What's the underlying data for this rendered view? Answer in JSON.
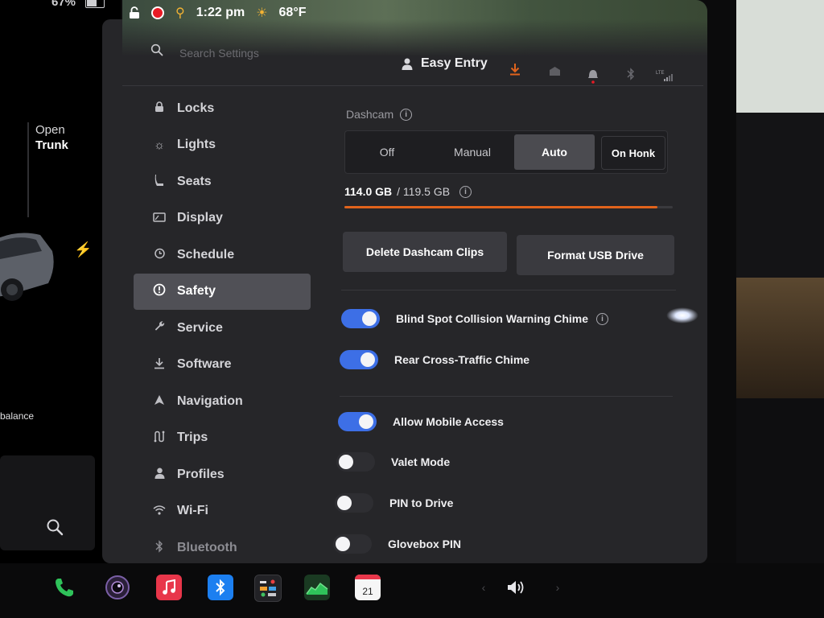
{
  "left_panel": {
    "battery": "67%",
    "trunk_line1": "Open",
    "trunk_line2": "Trunk",
    "balance_text": "balance"
  },
  "status": {
    "time": "1:22 pm",
    "temperature": "68°F"
  },
  "header": {
    "search_placeholder": "Search Settings",
    "profile_name": "Easy Entry",
    "icons": [
      "download-icon",
      "garage-icon",
      "bell-icon",
      "bluetooth-icon",
      "lte-signal-icon"
    ],
    "accent_download": "#e0631c",
    "bell_badge_color": "#e81b25"
  },
  "sidebar": {
    "items": [
      {
        "label": "Locks",
        "icon": "lock-icon"
      },
      {
        "label": "Lights",
        "icon": "light-icon"
      },
      {
        "label": "Seats",
        "icon": "seat-icon"
      },
      {
        "label": "Display",
        "icon": "display-icon"
      },
      {
        "label": "Schedule",
        "icon": "schedule-icon"
      },
      {
        "label": "Safety",
        "icon": "safety-icon",
        "active": true
      },
      {
        "label": "Service",
        "icon": "wrench-icon"
      },
      {
        "label": "Software",
        "icon": "download-icon"
      },
      {
        "label": "Navigation",
        "icon": "navigation-icon"
      },
      {
        "label": "Trips",
        "icon": "trips-icon"
      },
      {
        "label": "Profiles",
        "icon": "profile-icon"
      },
      {
        "label": "Wi-Fi",
        "icon": "wifi-icon"
      },
      {
        "label": "Bluetooth",
        "icon": "bluetooth-icon"
      }
    ]
  },
  "dashcam": {
    "label": "Dashcam",
    "options": [
      "Off",
      "Manual",
      "Auto",
      "On Honk"
    ],
    "selected": "Auto",
    "storage_used": "114.0 GB",
    "storage_total": "/ 119.5 GB",
    "storage_fraction": 0.954,
    "progress_color": "#e0631c",
    "delete_button": "Delete Dashcam Clips",
    "format_button": "Format USB Drive"
  },
  "toggles": [
    {
      "label": "Blind Spot Collision Warning Chime",
      "on": true,
      "info": true
    },
    {
      "label": "Rear Cross-Traffic Chime",
      "on": true
    },
    {
      "label": "Allow Mobile Access",
      "on": true
    },
    {
      "label": "Valet Mode",
      "on": false
    },
    {
      "label": "PIN to Drive",
      "on": false
    },
    {
      "label": "Glovebox PIN",
      "on": false
    }
  ],
  "toggle_on_color": "#3d6fe6",
  "dock": {
    "calendar_day": "21",
    "apps": [
      "phone-icon",
      "camera-icon",
      "music-icon",
      "bluetooth-icon",
      "toybox-icon",
      "energy-icon",
      "calendar-icon",
      "volume-icon"
    ]
  }
}
